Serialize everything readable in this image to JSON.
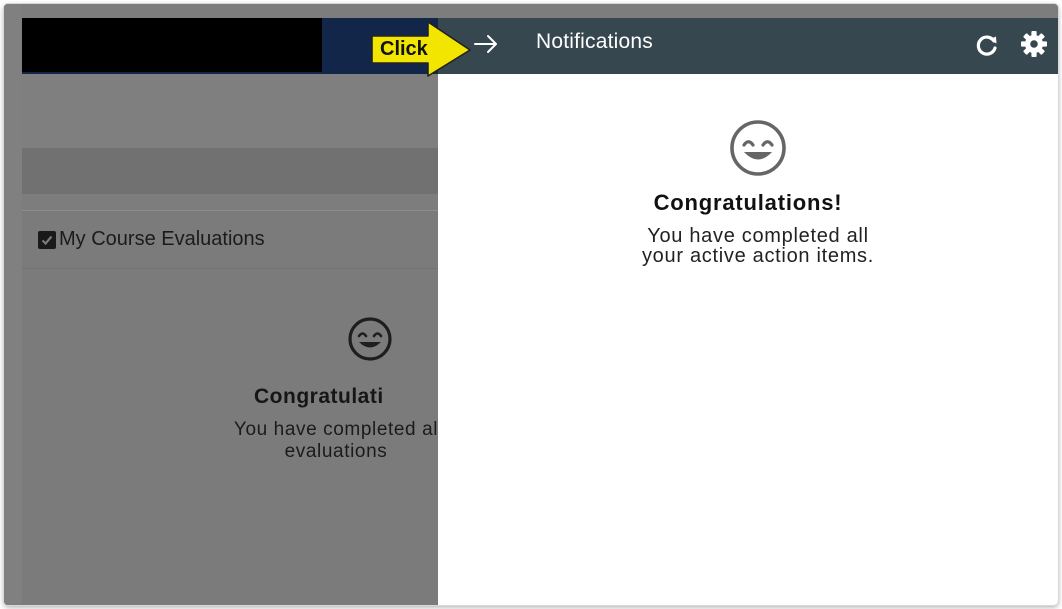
{
  "background_page": {
    "card_title": "My Course Evaluations",
    "congrats_text": "Congratulati",
    "message_line1": "You have completed al",
    "message_line2": "evaluations"
  },
  "notifications": {
    "title": "Notifications",
    "congrats_text": "Congratulations!",
    "message_line1": "You have completed all",
    "message_line2": "your active action items."
  },
  "callout": {
    "label": "Click",
    "color": "#f2e600"
  },
  "icons": {
    "back": "arrow-right-icon",
    "refresh": "refresh-icon",
    "settings": "gear-icon",
    "checkbox": "checkbox-checked-icon",
    "smile": "smiley-face-icon"
  },
  "colors": {
    "panel_header": "#37474f",
    "app_header": "#12264a",
    "overlay": "#7d7d7d"
  }
}
